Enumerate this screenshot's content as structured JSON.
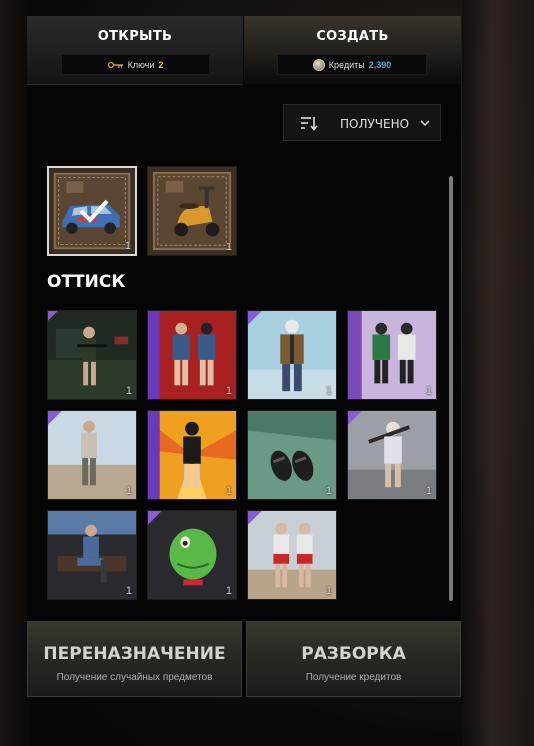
{
  "tabs": {
    "open": {
      "label": "ОТКРЫТЬ",
      "counter_label": "Ключи",
      "counter_value": "2",
      "icon": "key-icon"
    },
    "create": {
      "label": "СОЗДАТЬ",
      "counter_label": "Кредиты",
      "counter_value": "2,390",
      "icon": "credits-icon"
    }
  },
  "sort": {
    "label": "ПОЛУЧЕНО",
    "icon": "sort-icon"
  },
  "crates": [
    {
      "name": "vehicle-skin-car",
      "count": "1",
      "selected": true
    },
    {
      "name": "vehicle-skin-scooter",
      "count": "1",
      "selected": false
    }
  ],
  "section": {
    "title": "ОТТИСК"
  },
  "items": [
    {
      "name": "outfit-armed-soldier",
      "count": "1",
      "rarity": "legendary"
    },
    {
      "name": "outfit-denim-jacket-pair",
      "count": "1",
      "rarity": "legendary"
    },
    {
      "name": "outfit-mask-leather-jacket",
      "count": "1",
      "rarity": "legendary"
    },
    {
      "name": "outfit-green-jacket-pair",
      "count": "1",
      "rarity": "legendary"
    },
    {
      "name": "outfit-casual-man",
      "count": "1",
      "rarity": "legendary"
    },
    {
      "name": "outfit-cat-mask-woman",
      "count": "1",
      "rarity": "legendary"
    },
    {
      "name": "footwear-sandals",
      "count": "1",
      "rarity": "legendary"
    },
    {
      "name": "outfit-bat-girl",
      "count": "1",
      "rarity": "legendary"
    },
    {
      "name": "outfit-sitting-pilot",
      "count": "1",
      "rarity": "legendary"
    },
    {
      "name": "headwear-frog-mask",
      "count": "1",
      "rarity": "legendary"
    },
    {
      "name": "outfit-red-shorts-pair",
      "count": "1",
      "rarity": "legendary"
    }
  ],
  "actions": {
    "reassign": {
      "title": "ПЕРЕНАЗНАЧЕНИЕ",
      "subtitle": "Получение случайных предметов"
    },
    "dismantle": {
      "title": "РАЗБОРКА",
      "subtitle": "Получение кредитов"
    }
  },
  "colors": {
    "keys": "#e7c948",
    "credits": "#4fa5cf",
    "rarity_purple": "#8a5bd8",
    "rarity_gold": "#c79a54"
  }
}
